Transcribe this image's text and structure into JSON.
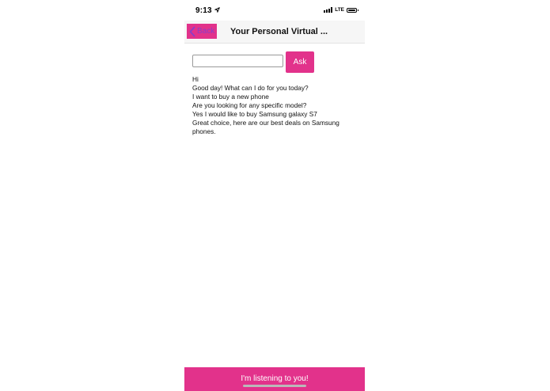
{
  "status_bar": {
    "time": "9:13",
    "network": "LTE",
    "location_icon": "location-arrow-icon",
    "signal_icon": "signal-bars-icon",
    "battery_icon": "battery-icon"
  },
  "nav": {
    "back_label": "Back",
    "back_icon": "chevron-left-icon",
    "title": "Your Personal Virtual ..."
  },
  "input": {
    "value": "",
    "placeholder": ""
  },
  "ask_button": {
    "label": "Ask"
  },
  "conversation": [
    "Hi",
    "Good day! What can I do for you today?",
    "I want to buy a new phone",
    "Are you looking for any specific model?",
    "Yes I would like to buy Samsung galaxy S7",
    "Great choice, here are our best deals on Samsung phones."
  ],
  "listening_bar": {
    "label": "I'm listening to you!"
  },
  "colors": {
    "accent": "#e2328b",
    "back_text": "#8a3fc8",
    "nav_background": "#f6f6f6"
  }
}
